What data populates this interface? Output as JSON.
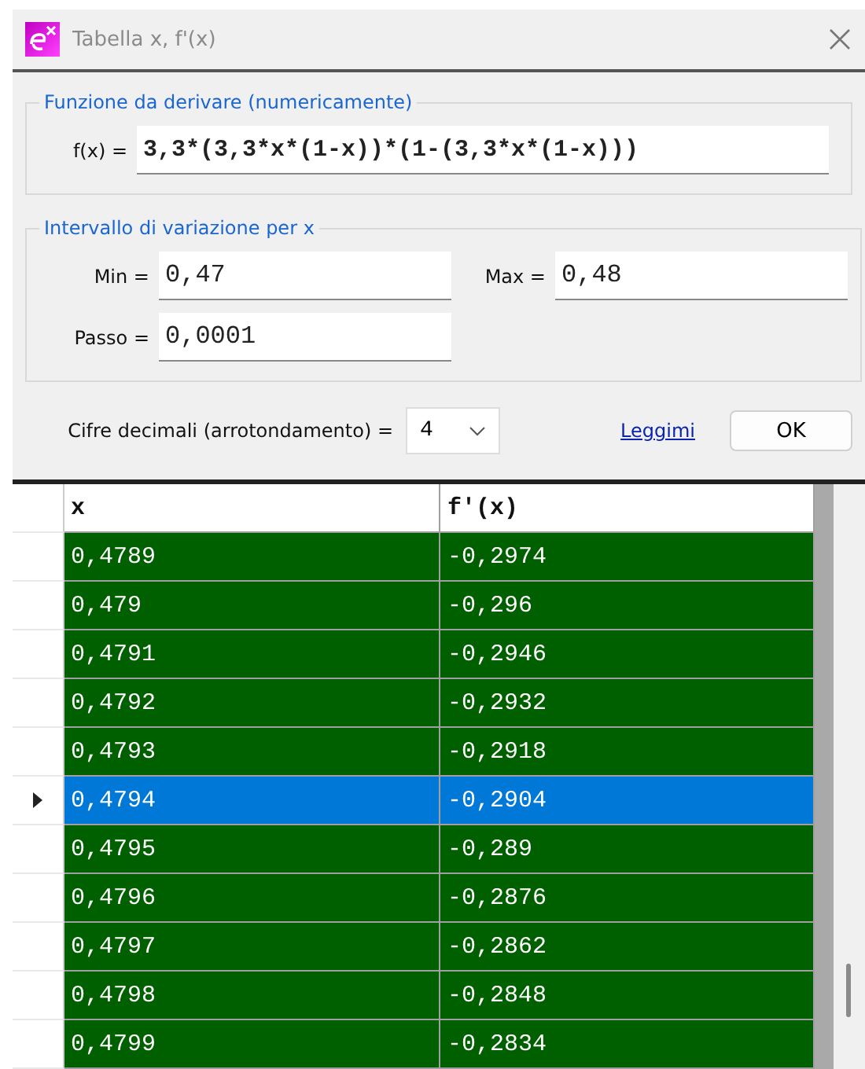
{
  "window": {
    "title": "Tabella x, f'(x)"
  },
  "function_group": {
    "legend": "Funzione da derivare (numericamente)",
    "label": "f(x) =",
    "value": "3,3*(3,3*x*(1-x))*(1-(3,3*x*(1-x)))"
  },
  "interval_group": {
    "legend": "Intervallo di variazione per x",
    "fields": [
      {
        "label": "Min =",
        "value": "0,47"
      },
      {
        "label": "Max =",
        "value": "0,48"
      },
      {
        "label": "Passo =",
        "value": "0,0001"
      }
    ]
  },
  "decimals": {
    "label": "Cifre decimali (arrotondamento) =",
    "value": "4"
  },
  "readme_link": "Leggimi",
  "ok_button": "OK",
  "table": {
    "columns": [
      "x",
      "f'(x)"
    ],
    "rows": [
      {
        "cells": [
          "0,4789",
          "-0,2974"
        ],
        "selected": false
      },
      {
        "cells": [
          "0,479",
          "-0,296"
        ],
        "selected": false
      },
      {
        "cells": [
          "0,4791",
          "-0,2946"
        ],
        "selected": false
      },
      {
        "cells": [
          "0,4792",
          "-0,2932"
        ],
        "selected": false
      },
      {
        "cells": [
          "0,4793",
          "-0,2918"
        ],
        "selected": false
      },
      {
        "cells": [
          "0,4794",
          "-0,2904"
        ],
        "selected": true
      },
      {
        "cells": [
          "0,4795",
          "-0,289"
        ],
        "selected": false
      },
      {
        "cells": [
          "0,4796",
          "-0,2876"
        ],
        "selected": false
      },
      {
        "cells": [
          "0,4797",
          "-0,2862"
        ],
        "selected": false
      },
      {
        "cells": [
          "0,4798",
          "-0,2848"
        ],
        "selected": false
      },
      {
        "cells": [
          "0,4799",
          "-0,2834"
        ],
        "selected": false
      }
    ]
  }
}
